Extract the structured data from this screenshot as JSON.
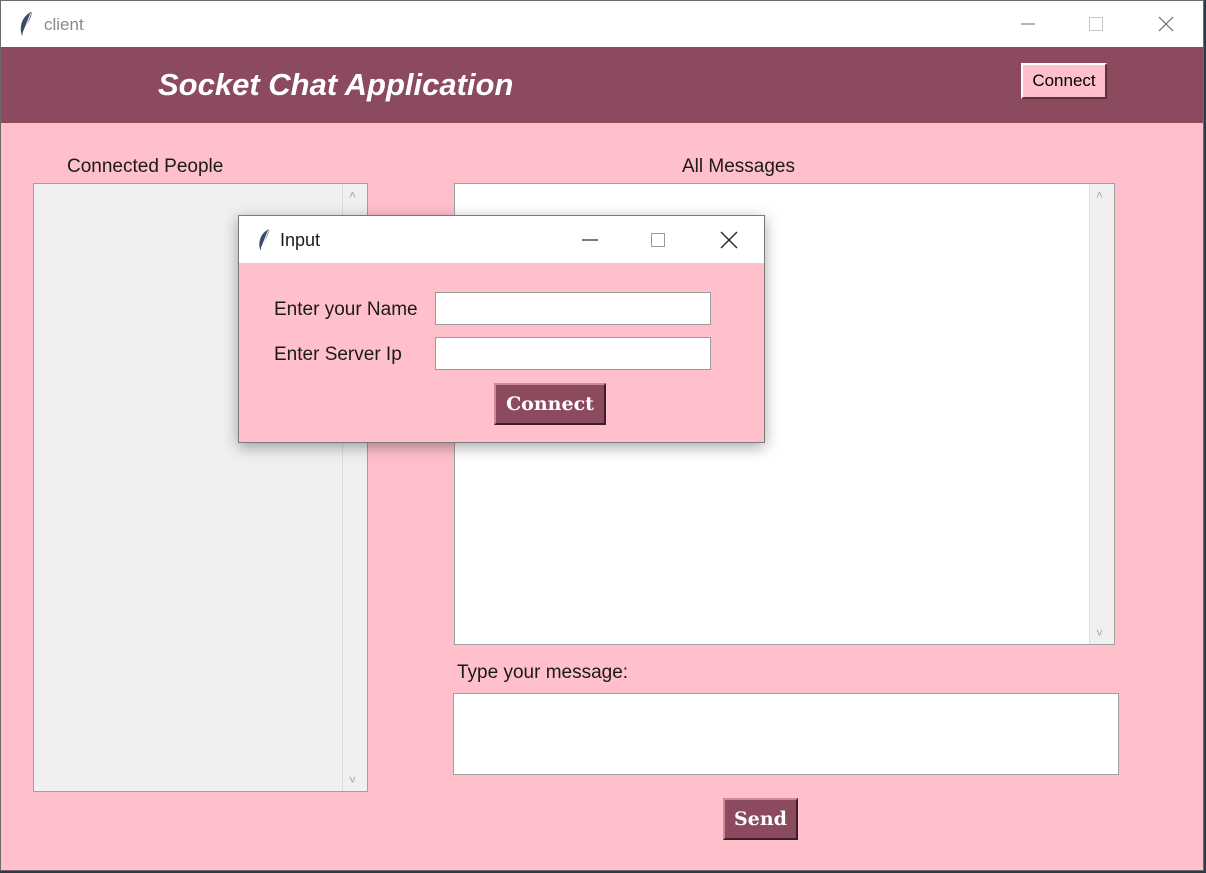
{
  "window": {
    "title": "client",
    "icon": "tk-feather-icon"
  },
  "header": {
    "app_title": "Socket Chat Application",
    "connect_label": "Connect"
  },
  "left_panel": {
    "label": "Connected People",
    "items": []
  },
  "messages": {
    "label": "All Messages",
    "items": []
  },
  "composer": {
    "label": "Type your message:",
    "value": "",
    "send_label": "Send"
  },
  "dialog": {
    "title": "Input",
    "name_label": "Enter your Name",
    "name_value": "",
    "ip_label": "Enter Server Ip",
    "ip_value": "",
    "connect_label": "Connect"
  },
  "colors": {
    "background": "#ffc0cb",
    "header": "#8b4a5e",
    "button_dark": "#8b4a5e"
  }
}
